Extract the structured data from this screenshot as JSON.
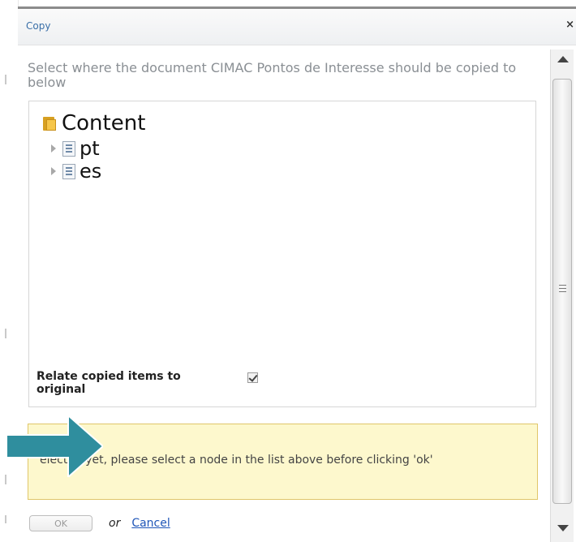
{
  "dialog": {
    "title": "Copy",
    "close_label": "×",
    "instruction": "Select where the document CIMAC Pontos de Interesse should be copied to below"
  },
  "tree": {
    "root": {
      "label": "Content",
      "icon": "folder-icon"
    },
    "children": [
      {
        "label": "pt",
        "icon": "document-icon"
      },
      {
        "label": "es",
        "icon": "document-icon"
      }
    ]
  },
  "options": {
    "relate_label": "Relate copied items to original",
    "relate_checked": true
  },
  "notice": {
    "text": "elected yet, please select a node in the list above before clicking 'ok'",
    "color": "#fdf8cd"
  },
  "footer": {
    "ok_label": "OK",
    "or_label": "or",
    "cancel_label": "Cancel"
  },
  "colors": {
    "title": "#3a6fa8",
    "arrow": "#2f8e9e",
    "link": "#1f56b8"
  }
}
